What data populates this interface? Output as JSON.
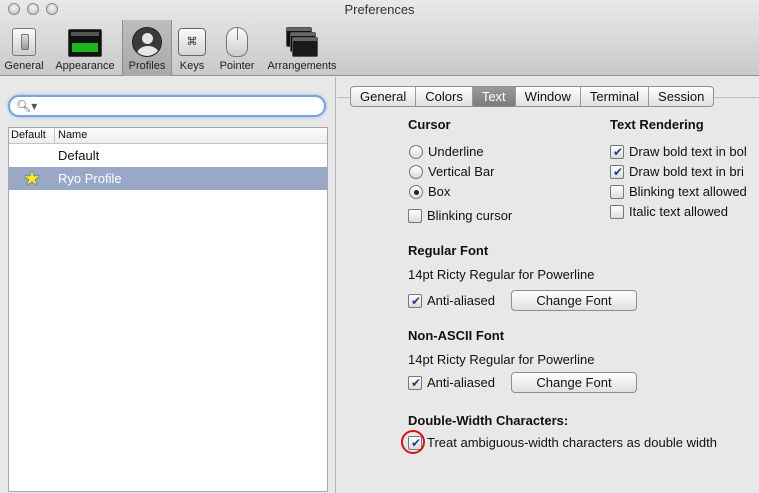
{
  "window": {
    "title": "Preferences"
  },
  "toolbar": {
    "items": [
      {
        "label": "General",
        "icon": "switch-icon"
      },
      {
        "label": "Appearance",
        "icon": "terminal-icon"
      },
      {
        "label": "Profiles",
        "icon": "profile-icon"
      },
      {
        "label": "Keys",
        "icon": "command-key-icon",
        "glyph": "⌘"
      },
      {
        "label": "Pointer",
        "icon": "mouse-icon"
      },
      {
        "label": "Arrangements",
        "icon": "windows-icon"
      }
    ],
    "selected": "Profiles"
  },
  "profiles": {
    "search": {
      "value": "",
      "placeholder": "",
      "icon": "search-icon",
      "glyph": "🔍︎▾"
    },
    "columns": {
      "default": "Default",
      "name": "Name"
    },
    "rows": [
      {
        "name": "Default",
        "is_default": false
      },
      {
        "name": "Ryo Profile",
        "is_default": true,
        "star": "★"
      }
    ],
    "selected": "Ryo Profile"
  },
  "tabs": [
    {
      "label": "General"
    },
    {
      "label": "Colors"
    },
    {
      "label": "Text"
    },
    {
      "label": "Window"
    },
    {
      "label": "Terminal"
    },
    {
      "label": "Session"
    }
  ],
  "active_tab": "Text",
  "text_settings": {
    "cursor": {
      "heading": "Cursor",
      "options": [
        {
          "label": "Underline",
          "selected": false
        },
        {
          "label": "Vertical Bar",
          "selected": false
        },
        {
          "label": "Box",
          "selected": true
        }
      ],
      "blinking": {
        "label": "Blinking cursor",
        "checked": false
      }
    },
    "text_rendering": {
      "heading": "Text Rendering",
      "options": [
        {
          "label": "Draw bold text in bol",
          "checked": true
        },
        {
          "label": "Draw bold text in bri",
          "checked": true
        },
        {
          "label": "Blinking text allowed",
          "checked": false
        },
        {
          "label": "Italic text allowed",
          "checked": false
        }
      ]
    },
    "regular_font": {
      "heading": "Regular Font",
      "font": "14pt Ricty Regular for Powerline",
      "anti_aliased": {
        "label": "Anti-aliased",
        "checked": true
      },
      "button": "Change Font"
    },
    "non_ascii_font": {
      "heading": "Non-ASCII Font",
      "font": "14pt Ricty Regular for Powerline",
      "anti_aliased": {
        "label": "Anti-aliased",
        "checked": true
      },
      "button": "Change Font"
    },
    "double_width": {
      "heading": "Double-Width Characters:",
      "option": {
        "label": "Treat ambiguous-width characters as double width",
        "checked": true
      }
    }
  },
  "colors": {
    "selection": "#9aa8c8",
    "highlight_ring": "#d0161a",
    "accent_focus": "#7ba3d8"
  }
}
